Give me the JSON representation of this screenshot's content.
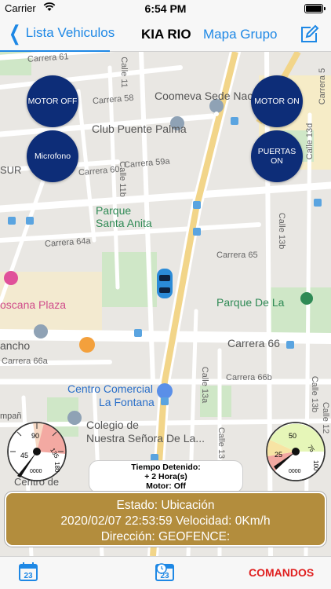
{
  "status_bar": {
    "carrier": "Carrier",
    "time": "6:54 PM"
  },
  "nav": {
    "back_label": "Lista Vehiculos",
    "title": "KIA RIO",
    "group_label": "Mapa Grupo",
    "accent_color": "#1e88e5"
  },
  "map": {
    "street_labels": [
      "Carrera 61",
      "Calle 11",
      "Carrera 58",
      "Carrera 59a",
      "Carrera 60",
      "Calle 11b",
      "Carrera 64a",
      "Carrera 65",
      "Calle 13b",
      "Carrera 66",
      "Carrera 66a",
      "Carrera 66b",
      "Calle 13a",
      "Calle 13b",
      "Calle 13",
      "Calle 12",
      "Calle 13d",
      "Carrera 5"
    ],
    "pois": {
      "coomeva": "Coomeva Sede Nac",
      "club": "Club Puente Palma",
      "parque_santa_anita_1": "Parque",
      "parque_santa_anita_2": "Santa Anita",
      "toscana": "oscana Plaza",
      "parque_de_la": "Parque De La",
      "rancho": "ancho",
      "centro_comercial_1": "Centro Comercial",
      "centro_comercial_2": "La Fontana",
      "colegio_1": "Colegio de",
      "colegio_2": "Nuestra Señora De La...",
      "sur": "SUR",
      "centro_de": "Centro de",
      "campa": "mpañ"
    }
  },
  "commands": {
    "motor_off": "MOTOR OFF",
    "motor_on": "MOTOR ON",
    "microfono": "Microfono",
    "puertas_on": "PUERTAS ON",
    "button_color": "#0d2d78"
  },
  "gauges": {
    "left": {
      "ticks": [
        "45",
        "90",
        "135",
        "180"
      ],
      "label": "0000"
    },
    "right": {
      "ticks": [
        "25",
        "50",
        "75",
        "100"
      ],
      "label": "0000"
    }
  },
  "time_box": {
    "line1": "Tiempo Detenido:",
    "line2": "+ 2 Hora(s)",
    "line3": "Motor: Off"
  },
  "estado": {
    "line1": "Estado: Ubicación",
    "line2": "2020/02/07 22:53:59 Velocidad: 0Km/h",
    "line3": "Dirección:  GEOFENCE:",
    "background": "#b38d3d"
  },
  "tabs": {
    "cal_left": "23",
    "cal_mid": "23",
    "comandos": "COMANDOS",
    "comandos_color": "#e02020"
  }
}
